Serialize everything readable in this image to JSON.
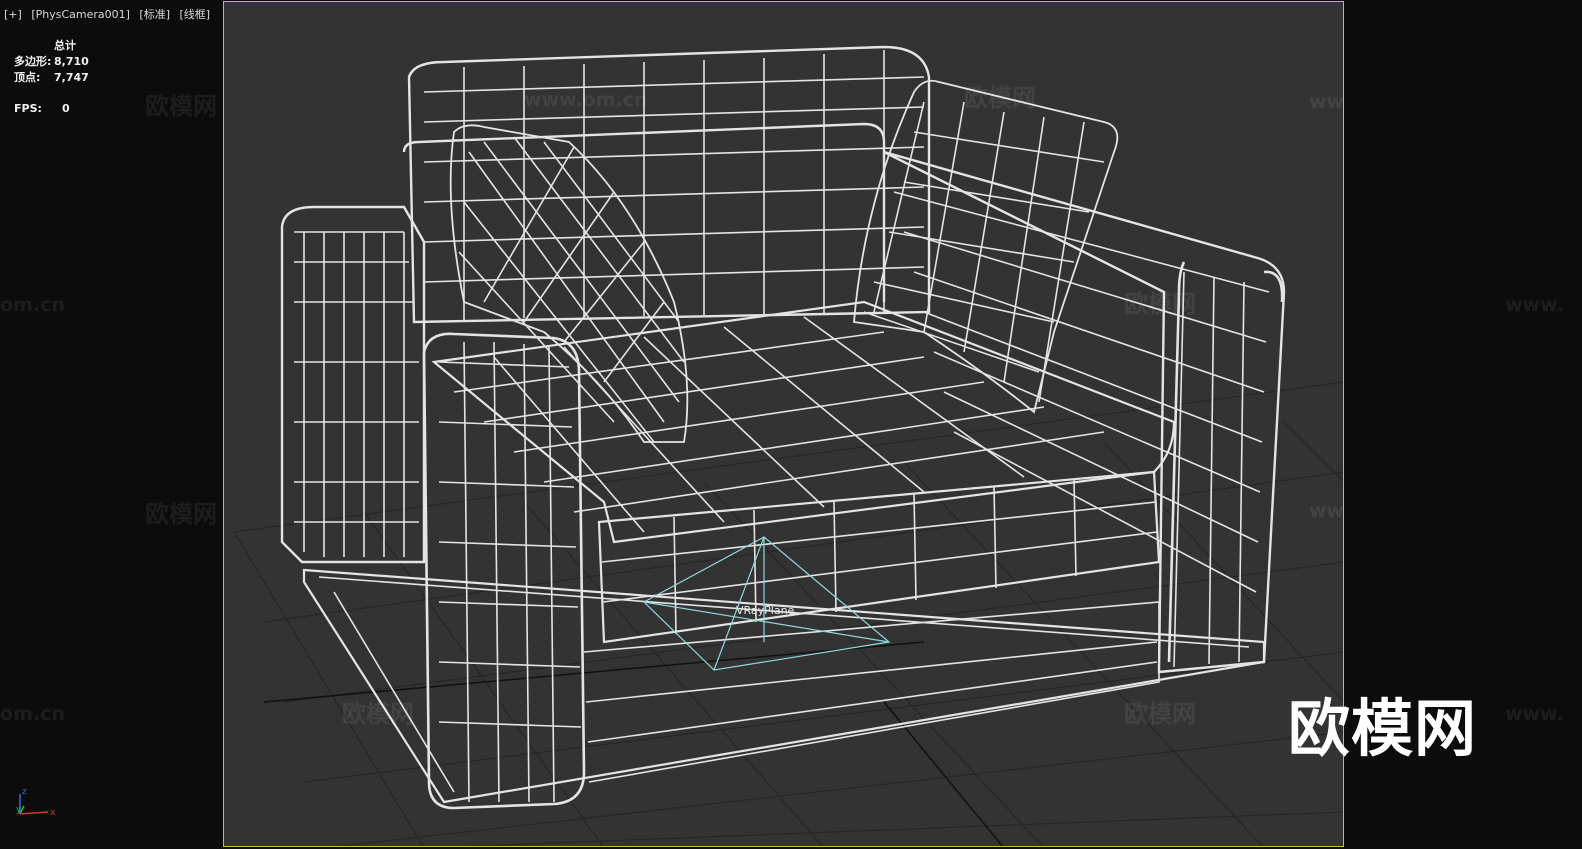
{
  "viewport": {
    "menu": "[+]",
    "camera": "[PhysCamera001]",
    "shading_mode": "[标准]",
    "display_mode": "[线框]"
  },
  "stats": {
    "header": "总计",
    "polygons_label": "多边形:",
    "polygons_value": "8,710",
    "vertices_label": "顶点:",
    "vertices_value": "7,747",
    "fps_label": "FPS:",
    "fps_value": "0"
  },
  "scene": {
    "object_label": "VRayPlane"
  },
  "watermarks": {
    "brand_cn": "欧模网",
    "brand_url": "www.om.cn",
    "brand_url_short": "om.cn",
    "brand_url_cut": "www."
  },
  "gizmo": {
    "x": "x",
    "y": "y",
    "z": "z"
  },
  "colors": {
    "viewport_bg": "#333333",
    "safe_frame": "#c8c23a",
    "wire": "#e4e4e4",
    "vray_plane": "#8fd8dc",
    "grid": "#262626"
  }
}
